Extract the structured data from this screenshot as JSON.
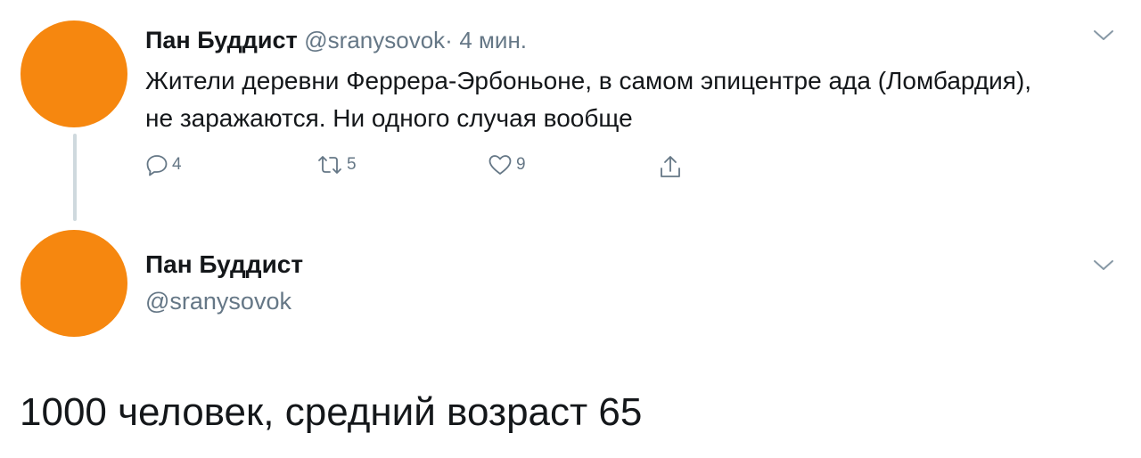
{
  "reply_tweet": {
    "display_name": "Пан Буддист",
    "handle": "@sranysovok",
    "separator": "·",
    "time": "4 мин.",
    "text": "Жители деревни Феррера-Эрбоньоне, в самом эпицентре ада (Ломбардия), не заражаются. Ни одного случая вообще",
    "actions": {
      "replies": "4",
      "retweets": "5",
      "likes": "9"
    }
  },
  "main_tweet": {
    "display_name": "Пан Буддист",
    "handle": "@sranysovok",
    "text": "1000 человек, средний возраст 65"
  },
  "icons": {
    "reply": "reply-icon",
    "retweet": "retweet-icon",
    "like": "heart-icon",
    "share": "share-icon",
    "menu": "chevron-down-icon"
  },
  "colors": {
    "avatar": "#f6870f",
    "secondary_text": "#657786",
    "thread_line": "#cfd9de"
  }
}
